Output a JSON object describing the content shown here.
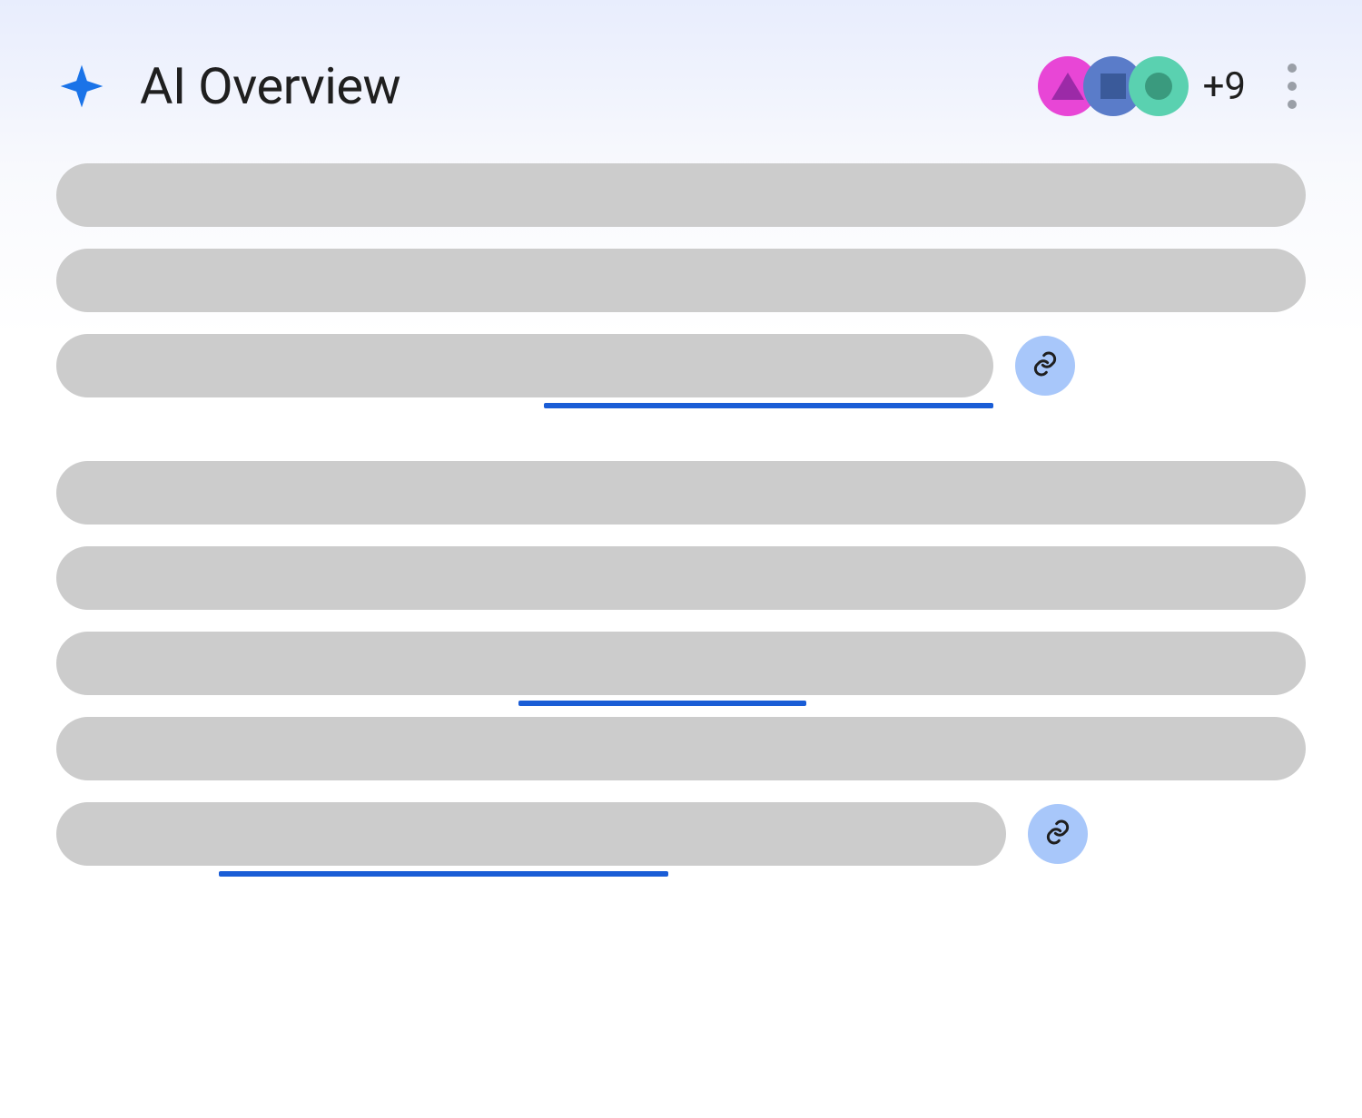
{
  "header": {
    "title": "AI Overview",
    "icon": "sparkle-icon",
    "sources": {
      "badges": [
        {
          "color": "magenta",
          "shape": "triangle"
        },
        {
          "color": "blue",
          "shape": "square"
        },
        {
          "color": "teal",
          "shape": "circle"
        }
      ],
      "overflow_count": "+9"
    },
    "menu_icon": "more-vertical-icon"
  },
  "content": {
    "paragraphs": [
      {
        "lines": [
          {
            "width_pct": 100
          },
          {
            "width_pct": 100
          },
          {
            "width_pct": 75,
            "has_link_chip": true,
            "underline": {
              "left_pct": 39,
              "width_pct": 36
            }
          }
        ]
      },
      {
        "lines": [
          {
            "width_pct": 100
          },
          {
            "width_pct": 100
          },
          {
            "width_pct": 100,
            "underline": {
              "left_pct": 37,
              "width_pct": 23
            }
          },
          {
            "width_pct": 100
          },
          {
            "width_pct": 76,
            "has_link_chip": true,
            "underline": {
              "left_pct": 13,
              "width_pct": 36
            }
          }
        ]
      }
    ]
  },
  "icons": {
    "link": "link-icon"
  }
}
